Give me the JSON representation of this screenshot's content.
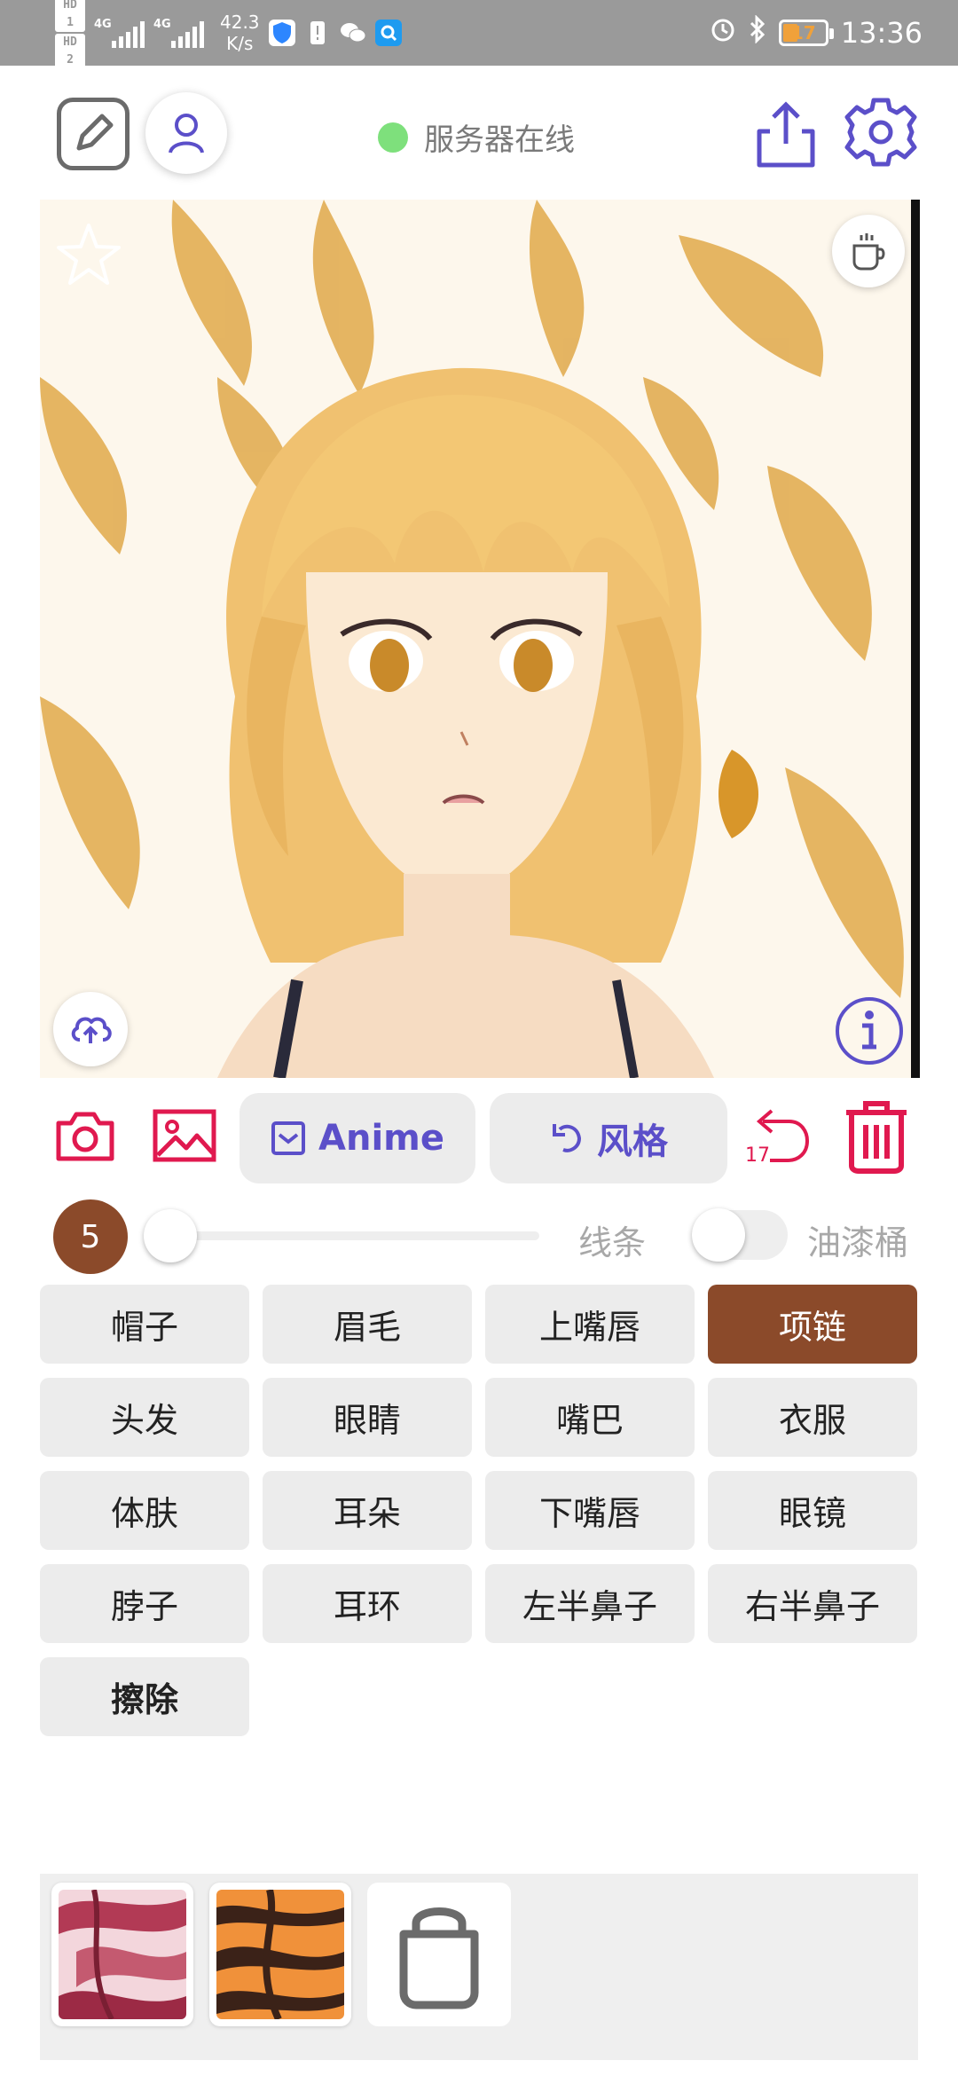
{
  "status_bar": {
    "hd1": "HD 1",
    "hd2": "HD 2",
    "net1": "4G",
    "net2": "4G",
    "speed_value": "42.3",
    "speed_unit": "K/s",
    "battery": "17",
    "time": "13:36"
  },
  "header": {
    "server_status": "服务器在线",
    "status_color": "#7ee07c"
  },
  "actions": {
    "anime_label": "Anime",
    "style_label": "风格",
    "undo_count": "17"
  },
  "brush": {
    "size": "5",
    "size_color": "#8b4a2a",
    "slider_level": 0.0,
    "line_label": "线条",
    "bucket_label": "油漆桶",
    "bucket_enabled": false
  },
  "parts": [
    {
      "label": "帽子",
      "active": false
    },
    {
      "label": "眉毛",
      "active": false
    },
    {
      "label": "上嘴唇",
      "active": false
    },
    {
      "label": "项链",
      "active": true
    },
    {
      "label": "头发",
      "active": false
    },
    {
      "label": "眼睛",
      "active": false
    },
    {
      "label": "嘴巴",
      "active": false
    },
    {
      "label": "衣服",
      "active": false
    },
    {
      "label": "体肤",
      "active": false
    },
    {
      "label": "耳朵",
      "active": false
    },
    {
      "label": "下嘴唇",
      "active": false
    },
    {
      "label": "眼镜",
      "active": false
    },
    {
      "label": "脖子",
      "active": false
    },
    {
      "label": "耳环",
      "active": false
    },
    {
      "label": "左半鼻子",
      "active": false
    },
    {
      "label": "右半鼻子",
      "active": false
    },
    {
      "label": "擦除",
      "active": false,
      "bold": true
    }
  ],
  "colors": {
    "accent_purple": "#5b4fc9",
    "accent_red": "#e0194f",
    "selected": "#8b4a2a"
  }
}
